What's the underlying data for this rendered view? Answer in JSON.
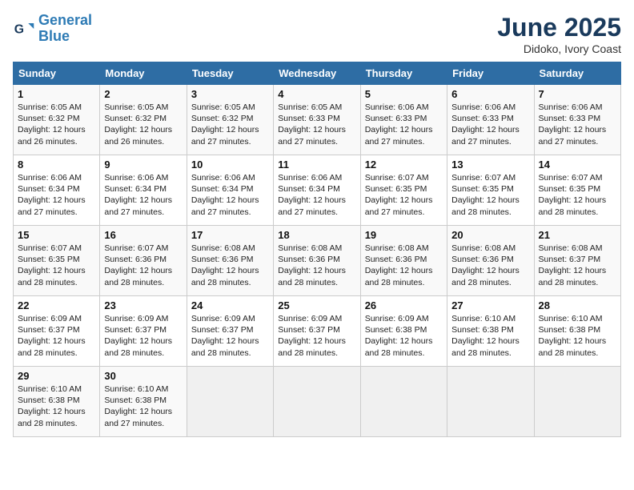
{
  "logo": {
    "line1": "General",
    "line2": "Blue"
  },
  "title": "June 2025",
  "subtitle": "Didoko, Ivory Coast",
  "days_of_week": [
    "Sunday",
    "Monday",
    "Tuesday",
    "Wednesday",
    "Thursday",
    "Friday",
    "Saturday"
  ],
  "weeks": [
    [
      {
        "day": "1",
        "info": "Sunrise: 6:05 AM\nSunset: 6:32 PM\nDaylight: 12 hours\nand 26 minutes."
      },
      {
        "day": "2",
        "info": "Sunrise: 6:05 AM\nSunset: 6:32 PM\nDaylight: 12 hours\nand 26 minutes."
      },
      {
        "day": "3",
        "info": "Sunrise: 6:05 AM\nSunset: 6:32 PM\nDaylight: 12 hours\nand 27 minutes."
      },
      {
        "day": "4",
        "info": "Sunrise: 6:05 AM\nSunset: 6:33 PM\nDaylight: 12 hours\nand 27 minutes."
      },
      {
        "day": "5",
        "info": "Sunrise: 6:06 AM\nSunset: 6:33 PM\nDaylight: 12 hours\nand 27 minutes."
      },
      {
        "day": "6",
        "info": "Sunrise: 6:06 AM\nSunset: 6:33 PM\nDaylight: 12 hours\nand 27 minutes."
      },
      {
        "day": "7",
        "info": "Sunrise: 6:06 AM\nSunset: 6:33 PM\nDaylight: 12 hours\nand 27 minutes."
      }
    ],
    [
      {
        "day": "8",
        "info": "Sunrise: 6:06 AM\nSunset: 6:34 PM\nDaylight: 12 hours\nand 27 minutes."
      },
      {
        "day": "9",
        "info": "Sunrise: 6:06 AM\nSunset: 6:34 PM\nDaylight: 12 hours\nand 27 minutes."
      },
      {
        "day": "10",
        "info": "Sunrise: 6:06 AM\nSunset: 6:34 PM\nDaylight: 12 hours\nand 27 minutes."
      },
      {
        "day": "11",
        "info": "Sunrise: 6:06 AM\nSunset: 6:34 PM\nDaylight: 12 hours\nand 27 minutes."
      },
      {
        "day": "12",
        "info": "Sunrise: 6:07 AM\nSunset: 6:35 PM\nDaylight: 12 hours\nand 27 minutes."
      },
      {
        "day": "13",
        "info": "Sunrise: 6:07 AM\nSunset: 6:35 PM\nDaylight: 12 hours\nand 28 minutes."
      },
      {
        "day": "14",
        "info": "Sunrise: 6:07 AM\nSunset: 6:35 PM\nDaylight: 12 hours\nand 28 minutes."
      }
    ],
    [
      {
        "day": "15",
        "info": "Sunrise: 6:07 AM\nSunset: 6:35 PM\nDaylight: 12 hours\nand 28 minutes."
      },
      {
        "day": "16",
        "info": "Sunrise: 6:07 AM\nSunset: 6:36 PM\nDaylight: 12 hours\nand 28 minutes."
      },
      {
        "day": "17",
        "info": "Sunrise: 6:08 AM\nSunset: 6:36 PM\nDaylight: 12 hours\nand 28 minutes."
      },
      {
        "day": "18",
        "info": "Sunrise: 6:08 AM\nSunset: 6:36 PM\nDaylight: 12 hours\nand 28 minutes."
      },
      {
        "day": "19",
        "info": "Sunrise: 6:08 AM\nSunset: 6:36 PM\nDaylight: 12 hours\nand 28 minutes."
      },
      {
        "day": "20",
        "info": "Sunrise: 6:08 AM\nSunset: 6:36 PM\nDaylight: 12 hours\nand 28 minutes."
      },
      {
        "day": "21",
        "info": "Sunrise: 6:08 AM\nSunset: 6:37 PM\nDaylight: 12 hours\nand 28 minutes."
      }
    ],
    [
      {
        "day": "22",
        "info": "Sunrise: 6:09 AM\nSunset: 6:37 PM\nDaylight: 12 hours\nand 28 minutes."
      },
      {
        "day": "23",
        "info": "Sunrise: 6:09 AM\nSunset: 6:37 PM\nDaylight: 12 hours\nand 28 minutes."
      },
      {
        "day": "24",
        "info": "Sunrise: 6:09 AM\nSunset: 6:37 PM\nDaylight: 12 hours\nand 28 minutes."
      },
      {
        "day": "25",
        "info": "Sunrise: 6:09 AM\nSunset: 6:37 PM\nDaylight: 12 hours\nand 28 minutes."
      },
      {
        "day": "26",
        "info": "Sunrise: 6:09 AM\nSunset: 6:38 PM\nDaylight: 12 hours\nand 28 minutes."
      },
      {
        "day": "27",
        "info": "Sunrise: 6:10 AM\nSunset: 6:38 PM\nDaylight: 12 hours\nand 28 minutes."
      },
      {
        "day": "28",
        "info": "Sunrise: 6:10 AM\nSunset: 6:38 PM\nDaylight: 12 hours\nand 28 minutes."
      }
    ],
    [
      {
        "day": "29",
        "info": "Sunrise: 6:10 AM\nSunset: 6:38 PM\nDaylight: 12 hours\nand 28 minutes."
      },
      {
        "day": "30",
        "info": "Sunrise: 6:10 AM\nSunset: 6:38 PM\nDaylight: 12 hours\nand 27 minutes."
      },
      {
        "day": "",
        "info": ""
      },
      {
        "day": "",
        "info": ""
      },
      {
        "day": "",
        "info": ""
      },
      {
        "day": "",
        "info": ""
      },
      {
        "day": "",
        "info": ""
      }
    ]
  ]
}
